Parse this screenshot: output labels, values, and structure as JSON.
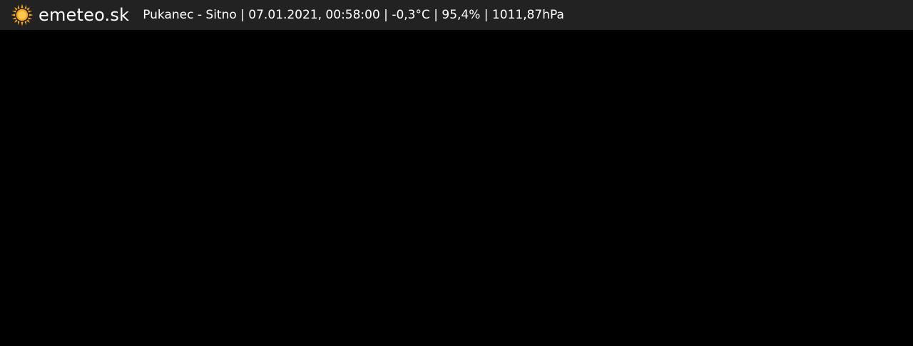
{
  "header": {
    "brand": "emeteo.sk",
    "logo_icon": "sun-icon",
    "logo_color": "#f5a623",
    "status_text": "Pukanec - Sitno | 07.01.2021, 00:58:00 | -0,3°C | 95,4% | 1011,87hPa"
  },
  "colors": {
    "bar_background": "#222222",
    "image_background": "#000000",
    "text": "#ffffff"
  }
}
